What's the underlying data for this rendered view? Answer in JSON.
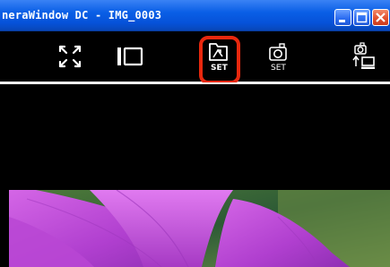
{
  "window": {
    "title": "neraWindow DC - IMG_0003",
    "controls": [
      "minimize",
      "maximize",
      "close"
    ]
  },
  "toolbar": {
    "tools": [
      {
        "icon": "full-screen-icon"
      },
      {
        "icon": "single-view-icon"
      },
      {
        "icon": "folder-settings-icon",
        "label": "SET",
        "highlighted": true
      },
      {
        "icon": "camera-settings-icon",
        "label": "SET"
      },
      {
        "icon": "camera-to-computer-icon"
      }
    ]
  },
  "colors": {
    "titlebar": "#0652d9",
    "toolbar": "#000000",
    "highlight_ring": "#e8280e",
    "flower": "#c04fd8"
  }
}
